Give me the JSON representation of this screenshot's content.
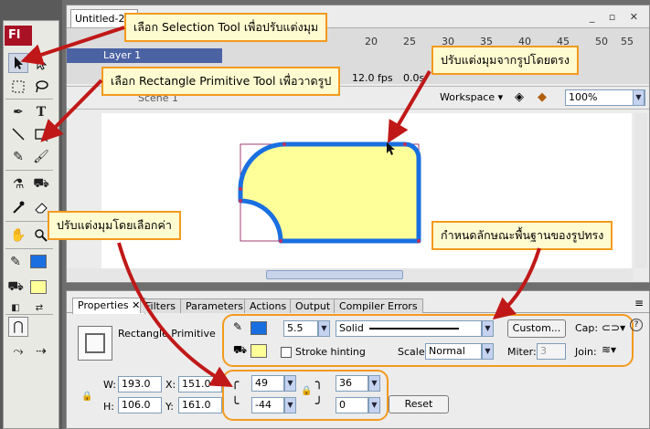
{
  "app": {
    "logo": "Fl",
    "document_tab": "Untitled-2*"
  },
  "callouts": {
    "selection": "เลือก Selection Tool เพื่อปรับแต่งมุม",
    "rectangle": "เลือก Rectangle Primitive Tool เพื่อวาดรูป",
    "direct": "ปรับแต่งมุมจากรูปโดยตรง",
    "by_value": "ปรับแต่งมุมโดยเลือกค่า",
    "basic": "กำหนดลักษณะพื้นฐานของรูปทรง"
  },
  "timeline": {
    "layer_name": "Layer 1",
    "ruler": [
      "20",
      "25",
      "30",
      "35",
      "40",
      "45",
      "50",
      "55"
    ],
    "fps": "12.0 fps",
    "time": "0.0s",
    "scene": "Scene 1"
  },
  "editbar": {
    "workspace": "Workspace",
    "zoom": "100%"
  },
  "properties": {
    "tabs": [
      "Properties",
      "Filters",
      "Parameters",
      "Actions",
      "Output",
      "Compiler Errors"
    ],
    "tool_name": "Rectangle Primitive",
    "stroke_size": "5.5",
    "stroke_style": "Solid",
    "custom_label": "Custom...",
    "cap_label": "Cap:",
    "join_label": "Join:",
    "stroke_hinting": "Stroke hinting",
    "scale_label": "Scale:",
    "scale_value": "Normal",
    "miter_label": "Miter:",
    "miter_value": "3",
    "w_label": "W:",
    "w": "193.0",
    "h_label": "H:",
    "h": "106.0",
    "x_label": "X:",
    "x": "151.0",
    "y_label": "Y:",
    "y": "161.0",
    "corner_tl": "49",
    "corner_tr": "36",
    "corner_bl": "-44",
    "corner_br": "0",
    "reset": "Reset"
  },
  "colors": {
    "stroke": "#1a6fe0",
    "fill": "#ffff9a",
    "accent": "#f39a1e",
    "arrow": "#c01818"
  }
}
